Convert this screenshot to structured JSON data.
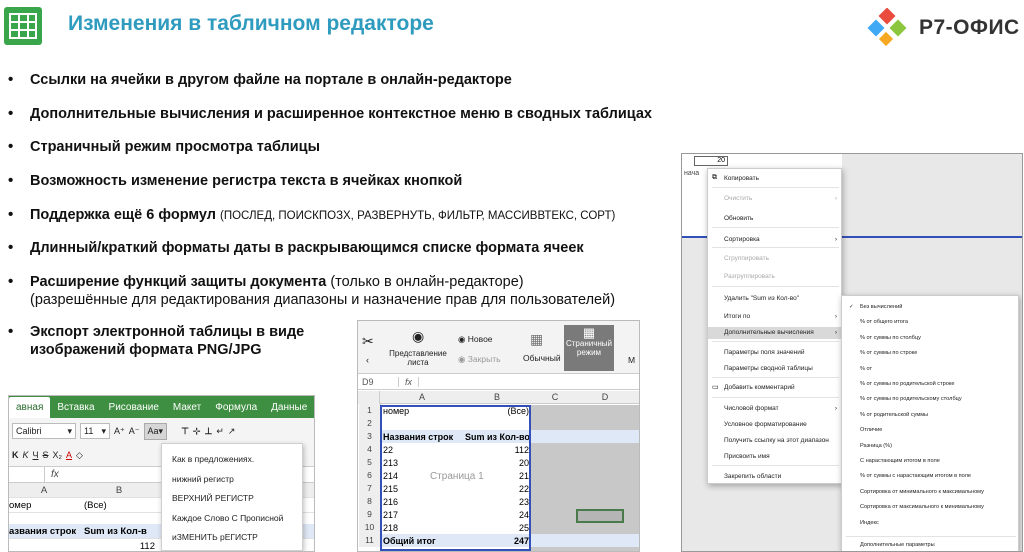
{
  "header": {
    "title": "Изменения в табличном редакторе",
    "brand": "Р7-ОФИС",
    "brand_colors": [
      "#e94b3c",
      "#3fa9f5",
      "#8cc63f",
      "#f7a823"
    ],
    "accent": "#2f9bbf",
    "sheet_icon_color": "#3aa64b"
  },
  "bullets": [
    {
      "text": "Ссылки на ячейки в другом файле на портале в онлайн-редакторе"
    },
    {
      "text": "Дополнительные вычисления и расширенное контекстное меню в сводных таблицах"
    },
    {
      "text": "Страничный режим просмотра таблицы"
    },
    {
      "text": "Возможность изменение регистра текста в ячейках кнопкой"
    },
    {
      "text": "Поддержка ещё 6 формул",
      "note": "(ПОСЛЕД, ПОИСКПОЗХ, РАЗВЕРНУТЬ, ФИЛЬТР, МАССИВВТЕКС, СОРТ)"
    },
    {
      "text": "Длинный/краткий форматы даты в раскрывающимся списке формата ячеек"
    },
    {
      "text": "Расширение функций защиты документа",
      "note": "(только в онлайн-редакторе)",
      "line2": "(разрешённые для редактирования диапазоны и назначение прав для пользователей)"
    },
    {
      "text": "Экспорт электронной таблицы в виде",
      "line2": "изображений формата PNG/JPG"
    }
  ],
  "shot1": {
    "tabs": [
      "авная",
      "Вставка",
      "Рисование",
      "Макет",
      "Формула",
      "Данные"
    ],
    "font_name": "Calibri",
    "font_size": "11",
    "grow_font": "A⁺",
    "shrink_font": "A⁻",
    "case_button": "Aa",
    "fx": "fx",
    "col_a": "A",
    "col_b": "B",
    "row1_a": "омер",
    "row1_b": "(Все)",
    "row2_a": "азвания строк",
    "row2_b": "Sum из Кол-в",
    "row3_b": "112",
    "case_menu": [
      "Как в предложениях.",
      "нижний регистр",
      "ВЕРХНИЙ РЕГИСТР",
      "Каждое Слово С Прописной",
      "иЗМЕНИТЬ рЕГИСТР"
    ]
  },
  "shot2": {
    "new_label": "Новое",
    "close_label": "Закрыть",
    "view_label": "Представление листа",
    "normal_label": "Обычный",
    "page_label": "Страничный режим",
    "cell_ref": "D9",
    "fx": "fx",
    "cols": [
      "A",
      "B",
      "C",
      "D"
    ],
    "rows": [
      {
        "n": "1",
        "a": "номер",
        "b": "(Все)"
      },
      {
        "n": "2",
        "a": "",
        "b": ""
      },
      {
        "n": "3",
        "a": "Названия строк",
        "b": "Sum из Кол-во"
      },
      {
        "n": "4",
        "a": "22",
        "b": "112"
      },
      {
        "n": "5",
        "a": "213",
        "b": "20"
      },
      {
        "n": "6",
        "a": "214",
        "b": "21"
      },
      {
        "n": "7",
        "a": "215",
        "b": "22"
      },
      {
        "n": "8",
        "a": "216",
        "b": "23"
      },
      {
        "n": "9",
        "a": "217",
        "b": "24"
      },
      {
        "n": "10",
        "a": "218",
        "b": "25"
      },
      {
        "n": "11",
        "a": "Общий итог",
        "b": "247"
      }
    ],
    "page_watermark": "Страница 1"
  },
  "shot3": {
    "cell_value": "20",
    "cell_label": "нача",
    "menu1": [
      {
        "label": "Копировать",
        "dis": false
      },
      {
        "label": "Очистить",
        "dis": true,
        "sub": true
      },
      {
        "label": "Обновить",
        "dis": false
      },
      {
        "label": "Сортировка",
        "dis": false,
        "sub": true
      },
      {
        "label": "Сгруппировать",
        "dis": true
      },
      {
        "label": "Разгруппировать",
        "dis": true
      },
      {
        "label": "Удалить \"Sum из Кол-во\"",
        "dis": false
      },
      {
        "label": "Итоги по",
        "dis": false,
        "sub": true
      },
      {
        "label": "Дополнительные вычисления",
        "dis": false,
        "sub": true
      },
      {
        "label": "Параметры поля значений",
        "dis": false
      },
      {
        "label": "Параметры сводной таблицы",
        "dis": false
      },
      {
        "label": "Добавить комментарий",
        "dis": false
      },
      {
        "label": "Числовой формат",
        "dis": false,
        "sub": true
      },
      {
        "label": "Условное форматирование",
        "dis": false
      },
      {
        "label": "Получить ссылку на этот диапазон",
        "dis": false
      },
      {
        "label": "Присвоить имя",
        "dis": false
      },
      {
        "label": "Закрепить области",
        "dis": false
      }
    ],
    "menu2": [
      "Без вычислений",
      "% от общего итога",
      "% от суммы по столбцу",
      "% от суммы по строке",
      "% от",
      "% от суммы по родительской строке",
      "% от суммы по родительскому столбцу",
      "% от родительской суммы",
      "Отличие",
      "Разница (%)",
      "С нарастающим итогом в поле",
      "% от суммы с нарастающим итогом в поле",
      "Сортировка от минимального к максимальному",
      "Сортировка от максимального к минимальному",
      "Индекс",
      "Дополнительные параметры"
    ]
  }
}
